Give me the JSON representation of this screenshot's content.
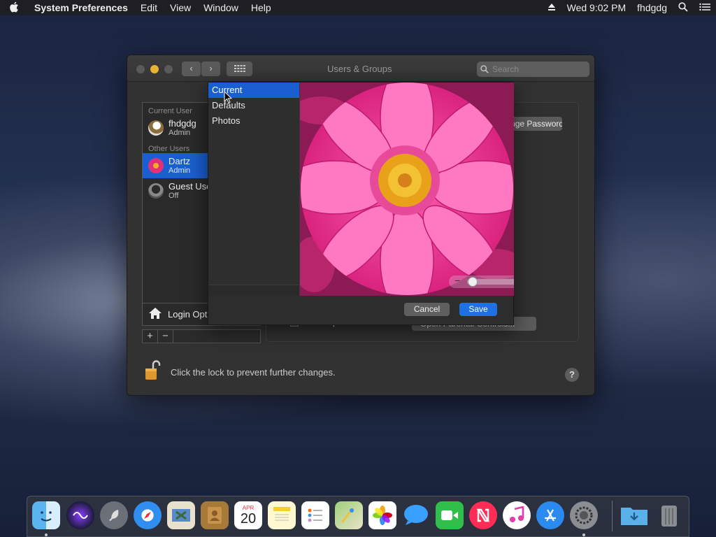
{
  "menubar": {
    "apple": "",
    "app": "System Preferences",
    "items": [
      "Edit",
      "View",
      "Window",
      "Help"
    ],
    "clock": "Wed 9:02 PM",
    "user": "fhdgdg",
    "status_icons": [
      "eject-icon",
      "search-icon",
      "menu-list-icon"
    ]
  },
  "window": {
    "title": "Users & Groups",
    "search_placeholder": "Search"
  },
  "users": {
    "current_label": "Current User",
    "current": {
      "name": "fhdgdg",
      "role": "Admin"
    },
    "other_label": "Other Users",
    "others": [
      {
        "name": "Dartz",
        "role": "Admin"
      },
      {
        "name": "Guest User",
        "role": "Off"
      }
    ],
    "login_options": "Login Options",
    "add": "+",
    "remove": "−"
  },
  "panel": {
    "password_button": "Change Password...",
    "parental_label": "Enable parental controls",
    "parental_button": "Open Parental Controls..."
  },
  "footer": {
    "lock_text": "Click the lock to prevent further changes.",
    "help": "?"
  },
  "picker": {
    "sources": [
      "Current",
      "Defaults",
      "Photos"
    ],
    "selected": "Current",
    "zoom_minus": "−",
    "zoom_plus": "+",
    "zoom_level": 0.05,
    "cancel": "Cancel",
    "save": "Save"
  },
  "dock": {
    "items": [
      "Finder",
      "Siri",
      "Launchpad",
      "Safari",
      "Mail",
      "Contacts",
      "Calendar",
      "Notes",
      "Reminders",
      "Maps",
      "Photos",
      "Messages",
      "FaceTime",
      "News",
      "iTunes",
      "App Store",
      "System Preferences",
      "Downloads",
      "Trash"
    ],
    "calendar_month": "APR",
    "calendar_day": "20"
  },
  "colors": {
    "accent": "#1a5fd1",
    "save": "#1f6fe5",
    "close": "#5a5a5a",
    "minimize": "#e8b330",
    "zoom": "#5a5a5a"
  }
}
